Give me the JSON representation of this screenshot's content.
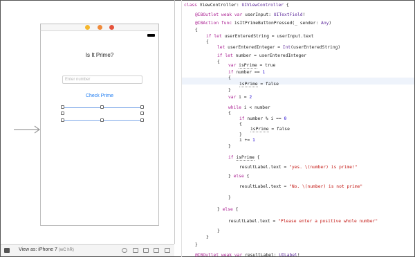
{
  "storyboard": {
    "title_label": "Is It Prime?",
    "input_placeholder": "Enter number",
    "button_label": "Check Prime",
    "view_as_label": "View as: iPhone 7",
    "view_as_shortcut": "(wC hR)"
  },
  "code": {
    "lines": [
      {
        "indent": 0,
        "text": "class ViewController: UIViewController {"
      },
      {
        "indent": 1,
        "text": "@IBOutlet weak var userInput: UITextField!"
      },
      {
        "indent": 1,
        "text": "@IBAction func isItPrimeButtonPressed(_ sender: Any)"
      },
      {
        "indent": 1,
        "text": "{"
      },
      {
        "indent": 2,
        "text": "if let userEnteredString = userInput.text"
      },
      {
        "indent": 2,
        "text": "{"
      },
      {
        "indent": 3,
        "text": "let userEnteredInteger = Int(userEnteredString)"
      },
      {
        "indent": 3,
        "text": "if let number = userEnteredInteger"
      },
      {
        "indent": 3,
        "text": "{"
      },
      {
        "indent": 4,
        "text": "var isPrime = true"
      },
      {
        "indent": 4,
        "text": "if number == 1"
      },
      {
        "indent": 4,
        "text": "{"
      },
      {
        "indent": 5,
        "text": "isPrime = false"
      },
      {
        "indent": 4,
        "text": "}"
      },
      {
        "indent": 4,
        "text": "var i = 2"
      },
      {
        "indent": 4,
        "text": "while i < number"
      },
      {
        "indent": 4,
        "text": "{"
      },
      {
        "indent": 5,
        "text": "if number % i == 0"
      },
      {
        "indent": 5,
        "text": "{"
      },
      {
        "indent": 6,
        "text": "isPrime = false"
      },
      {
        "indent": 5,
        "text": "}"
      },
      {
        "indent": 5,
        "text": "i += 1"
      },
      {
        "indent": 4,
        "text": "}"
      },
      {
        "indent": 4,
        "text": "if isPrime {"
      },
      {
        "indent": 5,
        "text": "resultLabel.text = \"yes. \\(number) is prime!\""
      },
      {
        "indent": 4,
        "text": "} else {"
      },
      {
        "indent": 5,
        "text": "resultLabel.text = \"No. \\(number) is not prime\""
      },
      {
        "indent": 4,
        "text": "}"
      },
      {
        "indent": 3,
        "text": "} else {"
      },
      {
        "indent": 4,
        "text": "resultLabel.text = \"Please enter a positive whole number\""
      },
      {
        "indent": 3,
        "text": "}"
      },
      {
        "indent": 2,
        "text": "}"
      },
      {
        "indent": 1,
        "text": "}"
      },
      {
        "indent": 1,
        "text": "@IBOutlet weak var resultLabel: UILabel!"
      }
    ]
  },
  "colors": {
    "keyword": "#aa1d91",
    "type": "#5b2699",
    "string": "#c41a16",
    "number": "#1c00cf",
    "link": "#1e7cf2"
  }
}
